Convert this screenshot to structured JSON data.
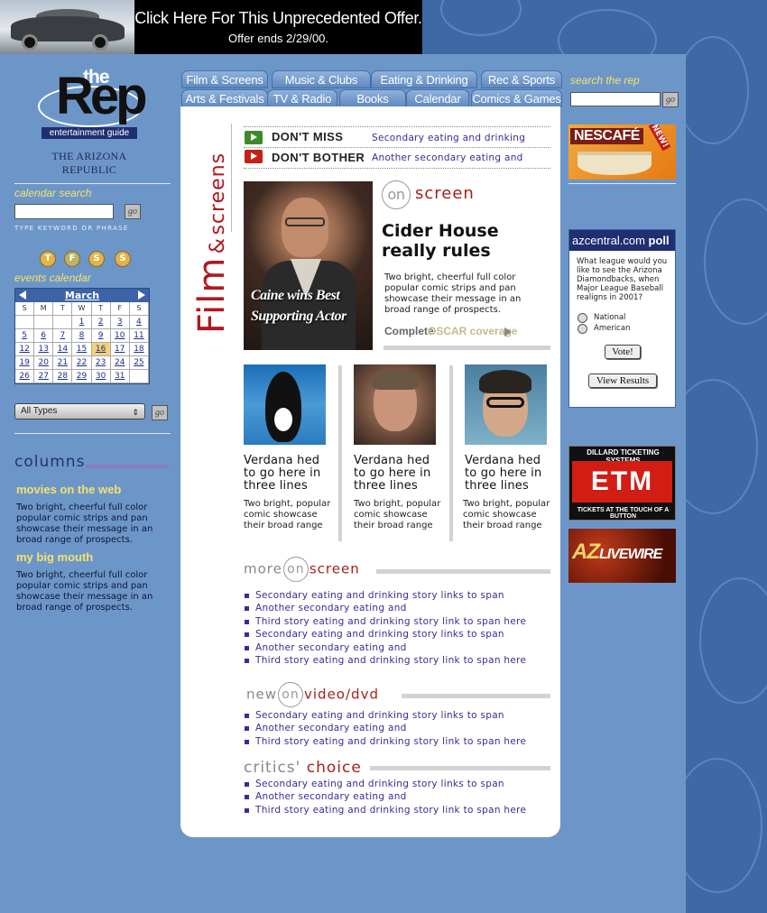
{
  "banner": {
    "headline": "Click Here For This Unprecedented Offer.",
    "subline": "Offer ends 2/29/00."
  },
  "logo": {
    "the": "the",
    "rep": "Rep",
    "tagline": "entertainment guide",
    "paper": "THE ARIZONA REPUBLIC"
  },
  "nav": {
    "row1": [
      "Film & Screens",
      "Music & Clubs",
      "Eating & Drinking",
      "Rec & Sports"
    ],
    "row2": [
      "Arts & Festivals",
      "TV & Radio",
      "Books",
      "Calendar",
      "Comics & Games"
    ]
  },
  "site_search": {
    "label": "search the rep",
    "go": "go"
  },
  "calendar_search": {
    "label": "calendar search",
    "go": "go",
    "hint": "TYPE KEYWORD OR PHRASE",
    "circles": [
      "T",
      "F",
      "S",
      "S"
    ]
  },
  "events_calendar": {
    "label": "events calendar",
    "month": "March",
    "dow": [
      "S",
      "M",
      "T",
      "W",
      "T",
      "F",
      "S"
    ],
    "days": [
      "",
      "",
      "",
      "1",
      "2",
      "3",
      "4",
      "5",
      "6",
      "7",
      "8",
      "9",
      "10",
      "11",
      "12",
      "13",
      "14",
      "15",
      "16",
      "17",
      "18",
      "19",
      "20",
      "21",
      "22",
      "23",
      "24",
      "25",
      "26",
      "27",
      "28",
      "29",
      "30",
      "31",
      ""
    ],
    "today": "16"
  },
  "type_filter": {
    "selected": "All Types",
    "go": "go"
  },
  "columns": {
    "title": "columns",
    "items": [
      {
        "title": "movies on the web",
        "text": "Two bright, cheerful full color popular comic strips and pan showcase their message in an broad range of prospects."
      },
      {
        "title": "my big mouth",
        "text": "Two bright, cheerful full color popular comic strips and pan showcase their message in an broad range of prospects."
      }
    ]
  },
  "section": {
    "title_big": "Film",
    "title_amp": "&",
    "title_small": "screens"
  },
  "dont": {
    "miss_label": "DON'T MISS",
    "miss_link": "Secondary eating and drinking",
    "bother_label": "DON'T BOTHER",
    "bother_link": "Another secondary eating and"
  },
  "feature": {
    "caption": "Caine wins Best Supporting Actor",
    "onscreen_on": "on",
    "onscreen_screen": "screen",
    "headline": "Cider House really rules",
    "body": "Two bright, cheerful full color popular comic strips and pan showcase their message in an broad range of prospects.",
    "complete": "Complete",
    "oscar": "OSCAR coverage"
  },
  "thumbs": [
    {
      "title": "Verdana hed to go here in three lines",
      "text": "Two bright, popular comic showcase their broad range"
    },
    {
      "title": "Verdana hed to go here in three lines",
      "text": "Two bright, popular comic showcase their broad range"
    },
    {
      "title": "Verdana hed to go here in three lines",
      "text": "Two bright, popular comic showcase their broad range"
    }
  ],
  "more_onscreen": {
    "pre": "more",
    "on": "on",
    "post": "screen",
    "links": [
      "Secondary eating and drinking story links to span",
      "Another secondary eating and",
      "Third story eating and drinking story link to span here",
      "Secondary eating and drinking story links to span",
      "Another secondary eating and",
      "Third story eating and drinking story link to span here"
    ]
  },
  "new_video": {
    "pre": "new",
    "on": "on",
    "post": "video/dvd",
    "links": [
      "Secondary eating and drinking story links to span",
      "Another secondary eating and",
      "Third story eating and drinking story link to span here"
    ]
  },
  "critics": {
    "pre": "critics'",
    "post": "choice",
    "links": [
      "Secondary eating and drinking story links to span",
      "Another secondary eating and",
      "Third story eating and drinking story link to span here"
    ]
  },
  "ads": {
    "nescafe": "NESCAFÉ",
    "nescafe_new": "NEW!",
    "etm_top": "DILLARD TICKETING SYSTEMS",
    "etm_mid": "ETM",
    "etm_bot": "TICKETS AT THE TOUCH OF A BUTTON",
    "az_a": "AZ",
    "az_b": "LIVEWIRE"
  },
  "poll": {
    "head_a": "azcentral.com",
    "head_b": "poll",
    "question": "What league would you like to see the Arizona Diamondbacks, when Major League Baseball realigns in 2001?",
    "options": [
      "National",
      "American"
    ],
    "vote": "Vote!",
    "results": "View Results"
  },
  "colors": {
    "page_bg": "#6d96c8",
    "accent_red": "#a3201d",
    "link_purple": "#3d2a92",
    "label_yellow": "#f4e26a"
  }
}
